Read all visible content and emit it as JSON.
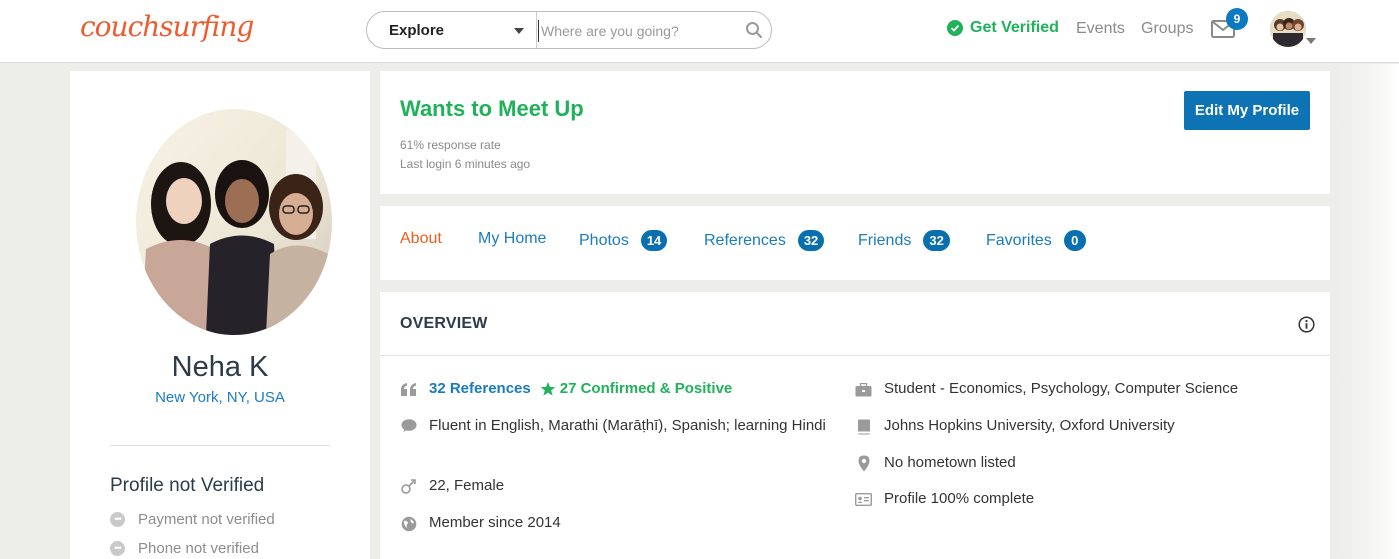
{
  "header": {
    "logo": "couchsurfing",
    "explore_label": "Explore",
    "search_placeholder": "Where are you going?",
    "get_verified": "Get Verified",
    "nav": [
      "Events",
      "Groups"
    ],
    "mail_count": "9",
    "colors": {
      "brand": "#ec5c2f",
      "green": "#1fb25a",
      "blue": "#0a79c2"
    }
  },
  "profile": {
    "name": "Neha K",
    "location": "New York, NY, USA",
    "verification_title": "Profile not Verified",
    "verification_items": [
      "Payment not verified",
      "Phone not verified"
    ]
  },
  "status": {
    "title": "Wants to Meet Up",
    "response_rate": "61% response rate",
    "last_login": "Last login 6 minutes ago",
    "edit_button": "Edit My Profile"
  },
  "tabs": [
    {
      "label": "About",
      "count": null
    },
    {
      "label": "My Home",
      "count": null
    },
    {
      "label": "Photos",
      "count": "14"
    },
    {
      "label": "References",
      "count": "32"
    },
    {
      "label": "Friends",
      "count": "32"
    },
    {
      "label": "Favorites",
      "count": "0"
    }
  ],
  "overview": {
    "title": "OVERVIEW",
    "references": "32 References",
    "confirmed": "27 Confirmed & Positive",
    "languages": "Fluent in English, Marathi (Marāṭhī), Spanish; learning Hindi",
    "age_gender": "22, Female",
    "member_since": "Member since 2014",
    "occupation": "Student - Economics, Psychology, Computer Science",
    "education": "Johns Hopkins University, Oxford University",
    "hometown": "No hometown listed",
    "completeness": "Profile 100% complete"
  }
}
